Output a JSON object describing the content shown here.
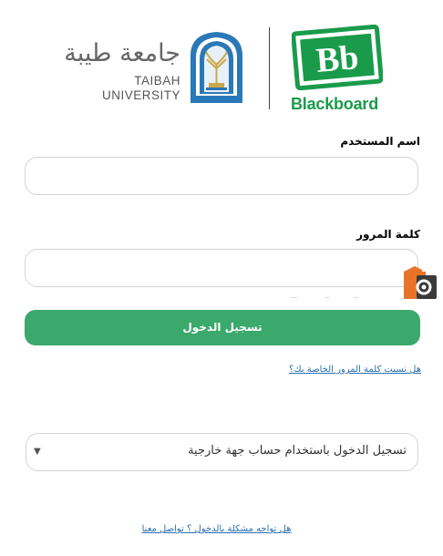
{
  "header": {
    "university_name_ar": "جامعة طيبة",
    "university_name_en": "TAIBAH UNIVERSITY",
    "platform_name": "Blackboard",
    "platform_logo_text": "Bb"
  },
  "form": {
    "username_label": "اسم المستخدم",
    "username_value": "",
    "password_label": "كلمة المرور",
    "password_value": "",
    "login_button": "تسجيل الدخول",
    "forgot_password_link": "هل نسيت كلمة المرور الخاصة بك؟",
    "external_login_selected": "تسجيل الدخول باستخدام حساب جهة خارجية",
    "help_link": "هل تواجه مشكلة بالدخول ؟ تواصل معنا"
  },
  "colors": {
    "brand_green": "#1a9b4b",
    "button_green": "#3ba96b",
    "link_blue": "#2a6fb5",
    "emblem_blue": "#2b78b8",
    "emblem_gold": "#c9a94a"
  },
  "icons": {
    "university_emblem": "taibah-emblem-icon",
    "blackboard_logo": "blackboard-logo-icon",
    "dropdown_caret": "caret-down-icon",
    "floating_widget": "camera-widget-icon"
  }
}
